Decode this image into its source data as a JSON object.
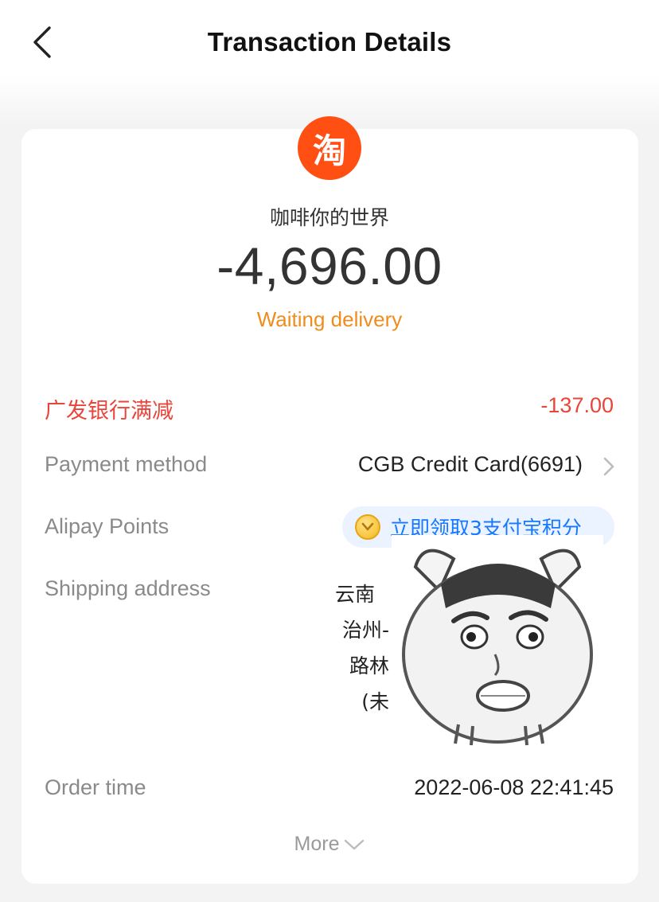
{
  "nav": {
    "title": "Transaction Details",
    "back_icon": "chevron-left-icon"
  },
  "merchant": {
    "logo_char": "淘",
    "logo_color": "#ff4f12",
    "name": "咖啡你的世界"
  },
  "amount": "-4,696.00",
  "status": "Waiting delivery",
  "status_color": "#f08c1d",
  "discount": {
    "label": "广发银行满减",
    "value": "-137.00",
    "color": "#e9453a"
  },
  "payment_method": {
    "label": "Payment method",
    "value": "CGB Credit Card(6691)"
  },
  "alipay_points": {
    "label": "Alipay Points",
    "cta": "立即领取3支付宝积分",
    "icon": "coin-icon",
    "cta_color": "#1677ff"
  },
  "shipping_address": {
    "label": "Shipping address",
    "lines": [
      "云南",
      "治州-",
      "路林",
      "(未"
    ],
    "lines_right_visible": [
      "",
      "",
      "",
      ""
    ]
  },
  "order_time": {
    "label": "Order time",
    "value": "2022-06-08 22:41:45"
  },
  "more": {
    "label": "More",
    "icon": "chevron-down-icon"
  }
}
